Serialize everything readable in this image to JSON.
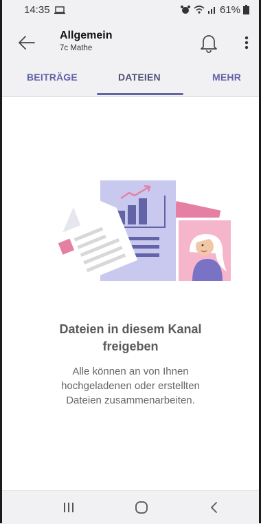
{
  "status_bar": {
    "time": "14:35",
    "battery": "61%"
  },
  "header": {
    "title": "Allgemein",
    "subtitle": "7c Mathe"
  },
  "tabs": [
    {
      "label": "BEITRÄGE",
      "selected": false
    },
    {
      "label": "DATEIEN",
      "selected": true
    },
    {
      "label": "MEHR",
      "selected": false
    }
  ],
  "empty_state": {
    "title_line1": "Dateien in diesem Kanal",
    "title_line2": "freigeben",
    "desc_line1": "Alle können an von Ihnen",
    "desc_line2": "hochgeladenen oder erstellten",
    "desc_line3": "Dateien zusammenarbeiten."
  },
  "colors": {
    "accent": "#6264a7",
    "header_bg": "#f1f1f3",
    "illustration_pink": "#e57fa4",
    "illustration_lavender": "#c9c9ef"
  },
  "icons": {
    "back": "arrow-left-icon",
    "bell": "bell-icon",
    "more": "more-vertical-icon",
    "nav_recent": "recent-apps-icon",
    "nav_home": "home-icon",
    "nav_back": "back-chevron-icon"
  }
}
